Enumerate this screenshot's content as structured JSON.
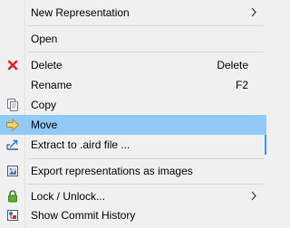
{
  "menu": {
    "items": [
      {
        "label": "New Representation",
        "shortcut": "",
        "submenu": true,
        "icon": ""
      },
      {
        "label": "Open",
        "shortcut": "",
        "submenu": false,
        "icon": ""
      },
      {
        "label": "Delete",
        "shortcut": "Delete",
        "submenu": false,
        "icon": "red-x-icon"
      },
      {
        "label": "Rename",
        "shortcut": "F2",
        "submenu": false,
        "icon": ""
      },
      {
        "label": "Copy",
        "shortcut": "",
        "submenu": false,
        "icon": "copy-icon"
      },
      {
        "label": "Move",
        "shortcut": "",
        "submenu": false,
        "icon": "move-arrow-icon",
        "highlighted": true
      },
      {
        "label": "Extract to .aird file ...",
        "shortcut": "",
        "submenu": false,
        "icon": "extract-icon"
      },
      {
        "label": "Export representations as images",
        "shortcut": "",
        "submenu": false,
        "icon": "export-image-icon"
      },
      {
        "label": "Lock / Unlock...",
        "shortcut": "",
        "submenu": true,
        "icon": "lock-icon"
      },
      {
        "label": "Show Commit History",
        "shortcut": "",
        "submenu": false,
        "icon": "commit-history-icon"
      }
    ]
  },
  "colors": {
    "highlight": "#91c9f7",
    "background": "#f0f0f0",
    "separator": "#d7d7d7",
    "delete_icon": "#e02424",
    "move_icon": "#f5c542",
    "lock_icon": "#4c9a2a"
  }
}
